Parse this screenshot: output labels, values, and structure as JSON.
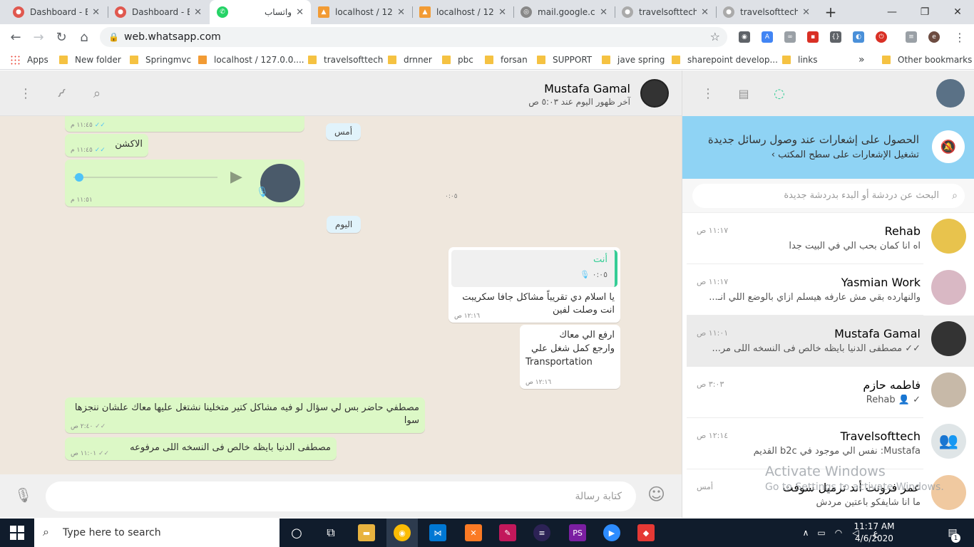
{
  "browser": {
    "tabs": [
      {
        "title": "Dashboard - B",
        "color": "#e0584f"
      },
      {
        "title": "Dashboard - B",
        "color": "#e0584f"
      },
      {
        "title": "واتساب",
        "color": "#25d366"
      },
      {
        "title": "localhost / 127",
        "color": "#f29b34"
      },
      {
        "title": "localhost / 127",
        "color": "#f29b34"
      },
      {
        "title": "mail.google.co",
        "color": "#888888"
      },
      {
        "title": "travelsofttech",
        "color": "#aaaaaa"
      },
      {
        "title": "travelsofttech",
        "color": "#aaaaaa"
      }
    ],
    "new_tab": "+",
    "url": "web.whatsapp.com",
    "bookmarks": [
      "Apps",
      "New folder",
      "Springmvc",
      "localhost / 127.0.0....",
      "travelsofttech",
      "drnner",
      "pbc",
      "forsan",
      "SUPPORT",
      "jave spring",
      "sharepoint develop...",
      "links"
    ],
    "more_bookmarks": "»",
    "other_bookmarks": "Other bookmarks"
  },
  "chat": {
    "contact_name": "Mustafa Gamal",
    "contact_status": "آخر ظهور اليوم عند ٥:٠٣ ص",
    "composer_placeholder": "كتابة رسالة",
    "messages": {
      "m1_time": "١١:٤٥ م",
      "m2_text": "الاكشن",
      "m2_time": "١١:٤٥ م",
      "voice_time": "١١:٥١ م",
      "day_yesterday": "أمس",
      "day_today": "اليوم",
      "duration": "٠:٠٥",
      "quote_author": "أنت",
      "quote_duration": "٠:٠٥",
      "m3_text": "يا اسلام دي تقريباً مشاكل جافا سكريبت انت وصلت لفين",
      "m3_time": "١٢:١٦ ص",
      "m4_line1": "ارفع الي معاك",
      "m4_line2": "وارجع كمل شغل علي",
      "m4_line3": "Transportation",
      "m4_time": "١٢:١٦ ص",
      "m5_text": "مصطفي حاضر بس لي سؤال لو فيه مشاكل كتير متخلينا نشتغل عليها معاك علشان ننجزها سوا",
      "m5_time": "٢:٤٠ ص",
      "m6_text": "مصطفى الدنيا بايظه خالص فى النسخه اللى مرفوعه",
      "m6_time": "١١:٠١ ص"
    }
  },
  "sidebar": {
    "notify_title": "الحصول على إشعارات عند وصول رسائل جديدة",
    "notify_sub": "تشغيل الإشعارات على سطح المكتب ›",
    "search_placeholder": "البحث عن دردشة أو البدء بدردشة جديدة",
    "chats": [
      {
        "name": "Rehab",
        "time": "١١:١٧ ص",
        "preview": "اه انا كمان بحب الي في البيت جدا"
      },
      {
        "name": "Yasmian  Work",
        "time": "١١:١٧ ص",
        "preview": "والنهارده بقي مش عارفه هيسلم ازاي بالوضع اللي انـ..."
      },
      {
        "name": "Mustafa Gamal",
        "time": "١١:٠١ ص",
        "preview": "✓✓ مصطفى الدنيا بايظه خالص فى النسخه اللى مر..."
      },
      {
        "name": "فاطمه حازم",
        "time": "٣:٠٣ ص",
        "preview": "✓ 👤 Rehab"
      },
      {
        "name": "Travelsofttech",
        "time": "١٢:١٤ ص",
        "preview": "Mustafa: نفس الي موجود في b2c القديم"
      },
      {
        "name": "عمر فرونت أند ترميل سوفت",
        "time": "أمس",
        "preview": "ما انا شايفكو باعتين مردش"
      }
    ]
  },
  "os": {
    "watermark_title": "Activate Windows",
    "watermark_sub": "Go to Settings to activate Windows.",
    "taskbar_search": "Type here to search",
    "clock_time": "11:17 AM",
    "clock_date": "4/6/2020",
    "lang": "ع",
    "notif_count": "1"
  }
}
